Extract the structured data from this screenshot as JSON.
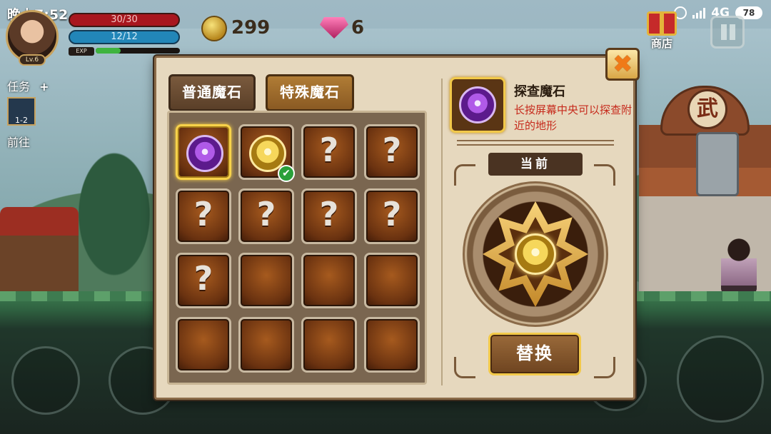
{
  "status_bar": {
    "time": "晚上7:52",
    "network": "4G",
    "battery": "78"
  },
  "player": {
    "level": "Lv.6",
    "hp": "30/30",
    "mp": "12/12",
    "exp_label": "EXP",
    "exp_progress": 0.3
  },
  "currency": {
    "gold": "299",
    "gems": "6"
  },
  "hud": {
    "shop_label": "商店",
    "quest_label": "任务",
    "quest_add": "+",
    "quest_stage": "1-2",
    "goto_label": "前往"
  },
  "dialog": {
    "tabs": [
      {
        "label": "普通魔石",
        "active": false
      },
      {
        "label": "特殊魔石",
        "active": true
      }
    ],
    "slots": [
      {
        "type": "purple-orb",
        "selected": true,
        "equipped": false
      },
      {
        "type": "gold-orb",
        "selected": false,
        "equipped": true
      },
      {
        "type": "unknown"
      },
      {
        "type": "unknown"
      },
      {
        "type": "unknown"
      },
      {
        "type": "unknown"
      },
      {
        "type": "unknown"
      },
      {
        "type": "unknown"
      },
      {
        "type": "unknown"
      },
      {
        "type": "empty"
      },
      {
        "type": "empty"
      },
      {
        "type": "empty"
      },
      {
        "type": "empty"
      },
      {
        "type": "empty"
      },
      {
        "type": "empty"
      },
      {
        "type": "empty"
      }
    ],
    "unknown_symbol": "?",
    "check_symbol": "✔",
    "info": {
      "title": "探查魔石",
      "description": "长按屏幕中央可以探查附近的地形"
    },
    "current_label": "当前",
    "replace_label": "替换"
  },
  "scenery": {
    "shop_sign": "武"
  },
  "colors": {
    "panel_bg": "#e6d8be",
    "accent_gold": "#f2c94a",
    "desc_red": "#c62a1c"
  }
}
